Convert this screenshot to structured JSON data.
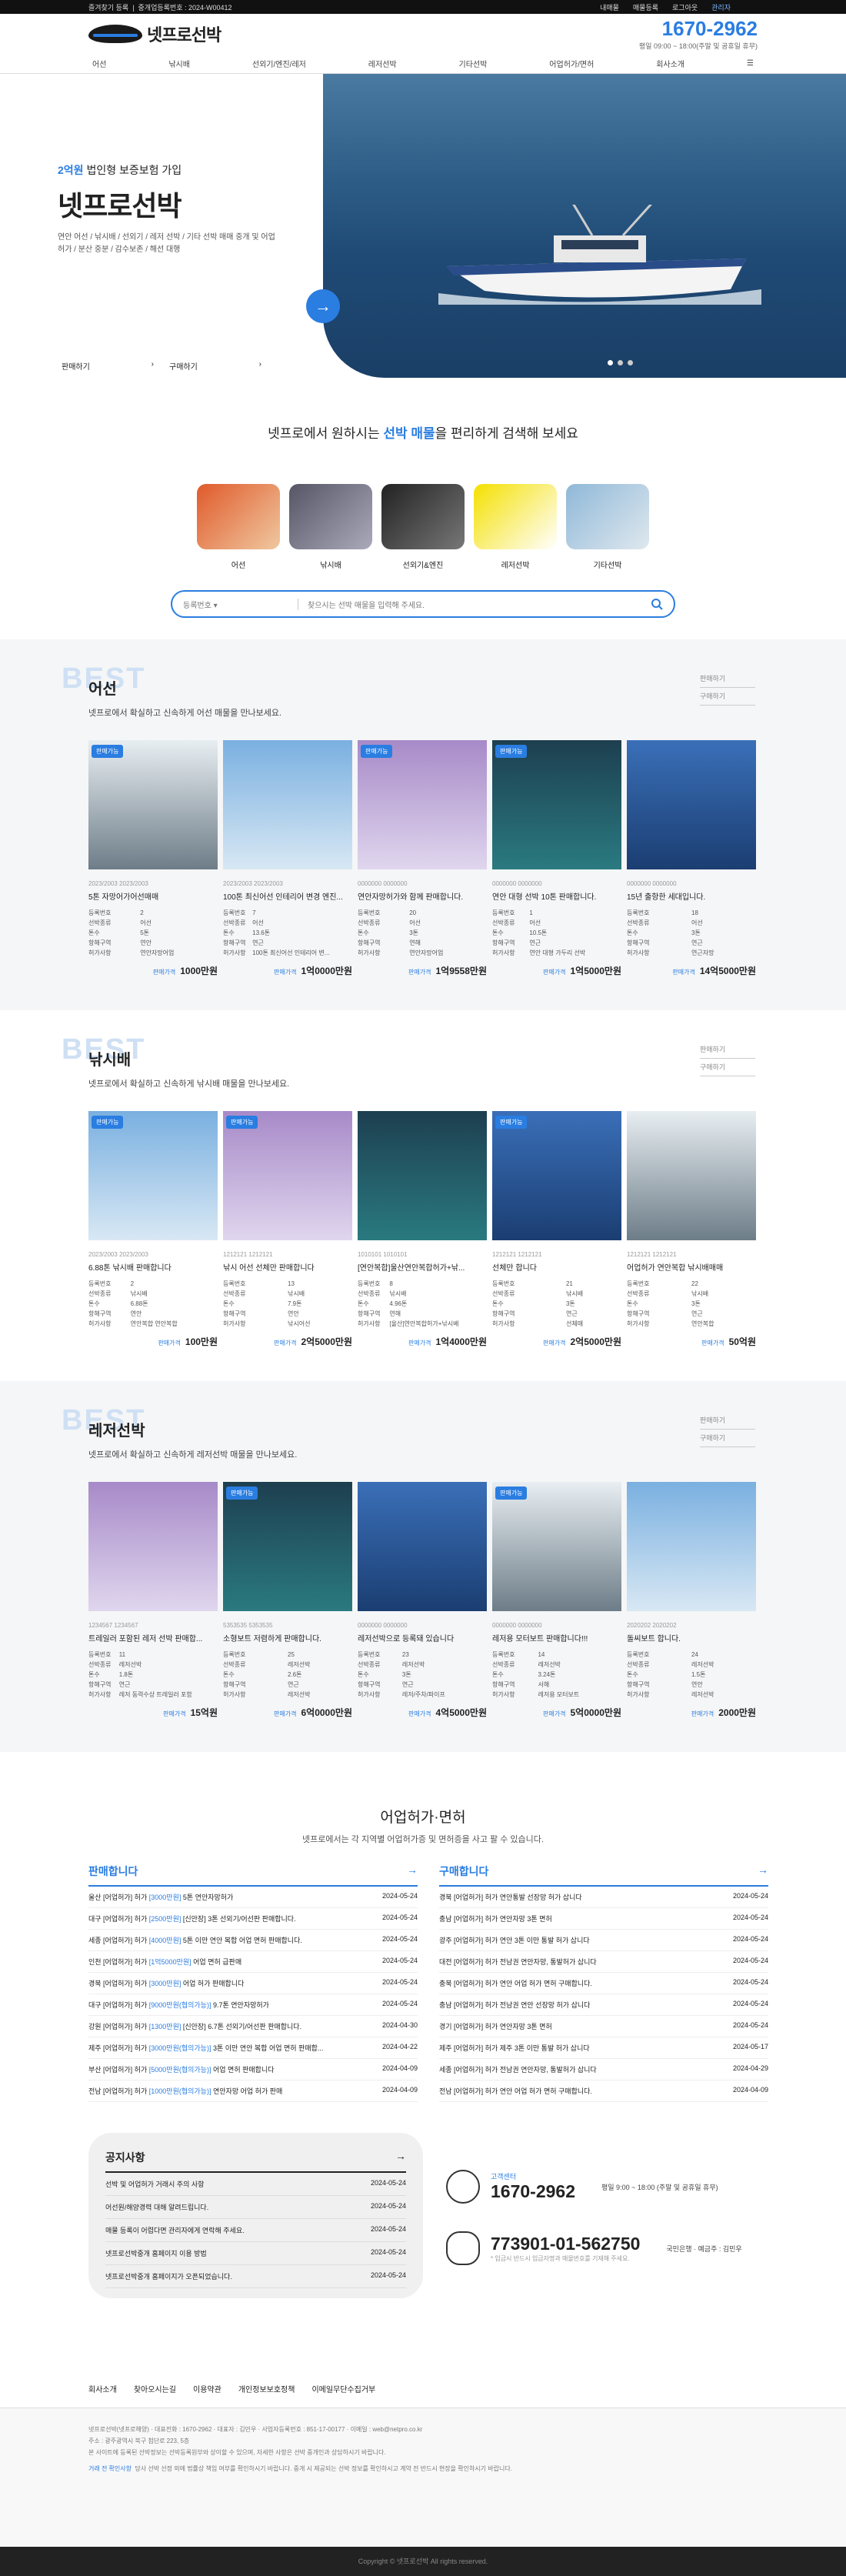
{
  "topbar": {
    "left1": "즐겨찾기 등록",
    "left2": "중개업등록번호 : 2024-W00412",
    "links": [
      "내매물",
      "매물등록",
      "로그아웃",
      "관리자"
    ]
  },
  "header": {
    "logo": "넷프로선박",
    "tel": "1670-2962",
    "hours": "평일 09:00 ~ 18:00(주말 및 공휴일 휴무)"
  },
  "nav": [
    "어선",
    "낚시배",
    "선외기/엔진/레저",
    "레저선박",
    "기타선박",
    "어업허가/면허",
    "회사소개",
    "☰"
  ],
  "hero": {
    "badge_pre": "2억원",
    "badge_post": "법인형 보증보험 가입",
    "title": "넷프로선박",
    "desc": "연안 어선 / 낚시배 / 선외기 / 레저 선박 / 기타 선박 매매 중개 및 어업허가 / 분산 중분 / 감수보존 / 해선 대행",
    "link1": "판매하기",
    "link2": "구매하기",
    "chev": "›",
    "arrow": "→"
  },
  "search": {
    "title_pre": "넷프로에서 원하시는",
    "title_hl": "선박 매물",
    "title_post": "을 편리하게 검색해 보세요",
    "cats": [
      "어선",
      "낚시배",
      "선외기&엔진",
      "레저선박",
      "기타선박"
    ],
    "select": "등록번호",
    "placeholder": "찾으시는 선박 매물을 입력해 주세요.",
    "icon": "search-icon"
  },
  "sections": [
    {
      "best": "BEST",
      "title": "어선",
      "desc": "넷프로에서 확실하고 신속하게 어선 매물을 만나보세요.",
      "mini": [
        "판매하기",
        "구매하기"
      ],
      "cards": [
        {
          "tag": "판매가능",
          "code": "2023/2003 2023/2003",
          "title": "5톤 자망어가어선매매",
          "rows": [
            [
              "등록번호",
              "2"
            ],
            [
              "선박종류",
              "어선"
            ],
            [
              "톤수",
              "5톤"
            ],
            [
              "항해구역",
              "연안"
            ],
            [
              "허가사항",
              "연안자망어업"
            ]
          ],
          "label": "판매가격",
          "price": "1000만원"
        },
        {
          "tag": "",
          "code": "2023/2003 2023/2003",
          "title": "100톤 최신어선 인테리어 변경 엔진...",
          "rows": [
            [
              "등록번호",
              "7"
            ],
            [
              "선박종류",
              "어선"
            ],
            [
              "톤수",
              "13.6톤"
            ],
            [
              "항해구역",
              "연근"
            ],
            [
              "허가사항",
              "100톤 최신어선 인테리어 변..."
            ]
          ],
          "label": "판매가격",
          "price": "1억0000만원"
        },
        {
          "tag": "판매가능",
          "code": "0000000 0000000",
          "title": "연안자망허가와 함께 판매합니다.",
          "rows": [
            [
              "등록번호",
              "20"
            ],
            [
              "선박종류",
              "어선"
            ],
            [
              "톤수",
              "3톤"
            ],
            [
              "항해구역",
              "연해"
            ],
            [
              "허가사항",
              "연안자망어업"
            ]
          ],
          "label": "판매가격",
          "price": "1억9558만원"
        },
        {
          "tag": "판매가능",
          "code": "0000000 0000000",
          "title": "연안 대형 선박 10톤 판매합니다.",
          "rows": [
            [
              "등록번호",
              "1"
            ],
            [
              "선박종류",
              "어선"
            ],
            [
              "톤수",
              "10.5톤"
            ],
            [
              "항해구역",
              "연근"
            ],
            [
              "허가사항",
              "연안 대형 가두리 선박"
            ]
          ],
          "label": "판매가격",
          "price": "1억5000만원"
        },
        {
          "tag": "",
          "code": "0000000 0000000",
          "title": "15년 출항한 세대입니다.",
          "rows": [
            [
              "등록번호",
              "18"
            ],
            [
              "선박종류",
              "어선"
            ],
            [
              "톤수",
              "3톤"
            ],
            [
              "항해구역",
              "연근"
            ],
            [
              "허가사항",
              "연근자망"
            ]
          ],
          "label": "판매가격",
          "price": "14억5000만원"
        }
      ]
    },
    {
      "best": "BEST",
      "title": "낚시배",
      "desc": "넷프로에서 확실하고 신속하게 낚시배 매물을 만나보세요.",
      "mini": [
        "판매하기",
        "구매하기"
      ],
      "cards": [
        {
          "tag": "판매가능",
          "code": "2023/2003 2023/2003",
          "title": "6.88톤 낚시배 판매합니다",
          "rows": [
            [
              "등록번호",
              "2"
            ],
            [
              "선박종류",
              "낚시배"
            ],
            [
              "톤수",
              "6.88톤"
            ],
            [
              "항해구역",
              "연안"
            ],
            [
              "허가사항",
              "연안복합 연안복합"
            ]
          ],
          "label": "판매가격",
          "price": "100만원"
        },
        {
          "tag": "판매가능",
          "code": "1212121 1212121",
          "title": "낚시 어선 선체만 판매합니다",
          "rows": [
            [
              "등록번호",
              "13"
            ],
            [
              "선박종류",
              "낚시배"
            ],
            [
              "톤수",
              "7.9톤"
            ],
            [
              "항해구역",
              "연안"
            ],
            [
              "허가사항",
              "낚시어선"
            ]
          ],
          "label": "판매가격",
          "price": "2억5000만원"
        },
        {
          "tag": "",
          "code": "1010101 1010101",
          "title": "[연안복합]울산연안복합허가+낚...",
          "rows": [
            [
              "등록번호",
              "8"
            ],
            [
              "선박종류",
              "낚시배"
            ],
            [
              "톤수",
              "4.96톤"
            ],
            [
              "항해구역",
              "연해"
            ],
            [
              "허가사항",
              "[울산]연안복합허가+낚시배"
            ]
          ],
          "label": "판매가격",
          "price": "1억4000만원"
        },
        {
          "tag": "판매가능",
          "code": "1212121 1212121",
          "title": "선체만 합니다",
          "rows": [
            [
              "등록번호",
              "21"
            ],
            [
              "선박종류",
              "낚시배"
            ],
            [
              "톤수",
              "3톤"
            ],
            [
              "항해구역",
              "연근"
            ],
            [
              "허가사항",
              "선체매"
            ]
          ],
          "label": "판매가격",
          "price": "2억5000만원"
        },
        {
          "tag": "",
          "code": "1212121 1212121",
          "title": "어업허가 연안복합 낚시배매매",
          "rows": [
            [
              "등록번호",
              "22"
            ],
            [
              "선박종류",
              "낚시배"
            ],
            [
              "톤수",
              "3톤"
            ],
            [
              "항해구역",
              "연근"
            ],
            [
              "허가사항",
              "연안복합"
            ]
          ],
          "label": "판매가격",
          "price": "50억원"
        }
      ]
    },
    {
      "best": "BEST",
      "title": "레저선박",
      "desc": "넷프로에서 확실하고 신속하게 레저선박 매물을 만나보세요.",
      "mini": [
        "판매하기",
        "구매하기"
      ],
      "cards": [
        {
          "tag": "",
          "code": "1234567 1234567",
          "title": "트레일러 포함된 레저 선박 판매합...",
          "rows": [
            [
              "등록번호",
              "11"
            ],
            [
              "선박종류",
              "레저선박"
            ],
            [
              "톤수",
              "1.8톤"
            ],
            [
              "항해구역",
              "연근"
            ],
            [
              "허가사항",
              "레저 동력수상 트레일러 포함"
            ]
          ],
          "label": "판매가격",
          "price": "15억원"
        },
        {
          "tag": "판매가능",
          "code": "5353535 5353535",
          "title": "소형보트 저렴하게 판매합니다.",
          "rows": [
            [
              "등록번호",
              "25"
            ],
            [
              "선박종류",
              "레저선박"
            ],
            [
              "톤수",
              "2.6톤"
            ],
            [
              "항해구역",
              "연근"
            ],
            [
              "허가사항",
              "레저선박"
            ]
          ],
          "label": "판매가격",
          "price": "6억0000만원"
        },
        {
          "tag": "",
          "code": "0000000 0000000",
          "title": "레저선박으로 등록돼 있습니다",
          "rows": [
            [
              "등록번호",
              "23"
            ],
            [
              "선박종류",
              "레저선박"
            ],
            [
              "톤수",
              "3톤"
            ],
            [
              "항해구역",
              "연근"
            ],
            [
              "허가사항",
              "레저/주차/파이프"
            ]
          ],
          "label": "판매가격",
          "price": "4억5000만원"
        },
        {
          "tag": "판매가능",
          "code": "0000000 0000000",
          "title": "레저용 모터보트 판매합니다!!!",
          "rows": [
            [
              "등록번호",
              "14"
            ],
            [
              "선박종류",
              "레저선박"
            ],
            [
              "톤수",
              "3.24톤"
            ],
            [
              "항해구역",
              "서해"
            ],
            [
              "허가사항",
              "레저용 모터보트"
            ]
          ],
          "label": "판매가격",
          "price": "5억0000만원"
        },
        {
          "tag": "",
          "code": "2020202 2020202",
          "title": "돌씨보트 합니다.",
          "rows": [
            [
              "등록번호",
              "24"
            ],
            [
              "선박종류",
              "레저선박"
            ],
            [
              "톤수",
              "1.5톤"
            ],
            [
              "항해구역",
              "연안"
            ],
            [
              "허가사항",
              "레저선박"
            ]
          ],
          "label": "판매가격",
          "price": "2000만원"
        }
      ]
    }
  ],
  "biz": {
    "title": "어업허가·면허",
    "sub": "넷프로에서는 각 지역별 어업허가증 및 면허증을 사고 팔 수 있습니다.",
    "sell": {
      "title": "판매합니다",
      "arrow": "→",
      "items": [
        {
          "a": "울산 [어업허가] 허가",
          "b": "[3000만원]",
          "c": "5톤 연안자망허가",
          "d": "2024-05-24"
        },
        {
          "a": "대구 [어업허가] 허가",
          "b": "[2500만원]",
          "c": "[신안장] 3톤 선외기/어선판 판매합니다.",
          "d": "2024-05-24"
        },
        {
          "a": "세종 [어업허가] 허가",
          "b": "[4000만원]",
          "c": "5톤 이만 연안 복합 어업 면허 판매합니다.",
          "d": "2024-05-24"
        },
        {
          "a": "인천 [어업허가] 허가",
          "b": "[1억5000만원]",
          "c": "어업 면허 급판매",
          "d": "2024-05-24"
        },
        {
          "a": "경북 [어업허가] 허가",
          "b": "[3000만원]",
          "c": "어업 허가 판매합니다",
          "d": "2024-05-24"
        },
        {
          "a": "대구 [어업허가] 허가",
          "b": "[9000만원(협의가능)]",
          "c": "9.7톤 연안자망허가",
          "d": "2024-05-24"
        },
        {
          "a": "강원 [어업허가] 허가",
          "b": "[1300만원]",
          "c": "[신안장] 6.7톤 선외기/어선판 판매합니다.",
          "d": "2024-04-30"
        },
        {
          "a": "제주 [어업허가] 허가",
          "b": "[3000만원(협의가능)]",
          "c": "3톤 이만 연안 복합 어업 면허 판매합...",
          "d": "2024-04-22"
        },
        {
          "a": "부산 [어업허가] 허가",
          "b": "[5000만원(협의가능)]",
          "c": "어업 면허 판매합니다",
          "d": "2024-04-09"
        },
        {
          "a": "전남 [어업허가] 허가",
          "b": "[1000만원(협의가능)]",
          "c": "연안자망 어업 허가 판매",
          "d": "2024-04-09"
        }
      ]
    },
    "buy": {
      "title": "구매합니다",
      "arrow": "→",
      "items": [
        {
          "a": "경북 [어업허가] 허가",
          "c": "연안통발 선장망 허가 삽니다",
          "d": "2024-05-24"
        },
        {
          "a": "충남 [어업허가] 허가",
          "c": "연안자망 3톤 면허",
          "d": "2024-05-24"
        },
        {
          "a": "광주 [어업허가] 허가",
          "c": "연안 3톤 이만 통발 허가 삽니다",
          "d": "2024-05-24"
        },
        {
          "a": "대전 [어업허가] 허가",
          "c": "전남권 연안자망, 통발허가 삽니다",
          "d": "2024-05-24"
        },
        {
          "a": "충북 [어업허가] 허가",
          "c": "연안 어업 허가 면허 구매합니다.",
          "d": "2024-05-24"
        },
        {
          "a": "충남 [어업허가] 허가",
          "c": "전남권 연안 선장망 허가 삽니다",
          "d": "2024-05-24"
        },
        {
          "a": "경기 [어업허가] 허가",
          "c": "연안자망 3톤 면허",
          "d": "2024-05-24"
        },
        {
          "a": "제주 [어업허가] 허가",
          "c": "제주 3톤 이만 통발 허가 삽니다",
          "d": "2024-05-17"
        },
        {
          "a": "세종 [어업허가] 허가",
          "c": "전남권 연안자망, 통발허가 삽니다",
          "d": "2024-04-29"
        },
        {
          "a": "전남 [어업허가] 허가",
          "c": "연안 어업 허가 면허 구매합니다.",
          "d": "2024-04-09"
        }
      ]
    }
  },
  "notice": {
    "title": "공지사항",
    "arrow": "→",
    "items": [
      {
        "t": "선박 및 어업허가 거래시 주의 사항",
        "d": "2024-05-24"
      },
      {
        "t": "어선원/해양경력 대해 알려드립니다.",
        "d": "2024-05-24"
      },
      {
        "t": "매물 등록이 어렵다면 관리자에게 연락해 주세요.",
        "d": "2024-05-24"
      },
      {
        "t": "넷프로선박중개 홈페이지 이용 방법",
        "d": "2024-05-24"
      },
      {
        "t": "넷프로선박중개 홈페이지가 오픈되었습니다.",
        "d": "2024-05-24"
      }
    ]
  },
  "contact": {
    "label": "고객센터",
    "tel": "1670-2962",
    "hours": "평일 9:00 ~ 18:00 (주말 및 공휴일 휴무)",
    "account": "773901-01-562750",
    "account_note": "* 입금시 반드시 입금자명과 매물번호를 기재해 주세요.",
    "bank": "국민은행 · 예금주 : 김민우"
  },
  "footer": {
    "links": [
      "회사소개",
      "찾아오시는길",
      "이용약관",
      "개인정보보호정책",
      "이메일무단수집거부"
    ],
    "info1": "넷프로선박(넷프로해양) · 대표전화 : 1670-2962 · 대표자 : 김민우 · 사업자등록번호 : 851-17-00177 · 이메일 : web@netpro.co.kr",
    "info2": "주소 : 광주광역시 북구 첨단로 223, 5층",
    "info3": "본 사이트에 등록된 선박정보는 선박등록원부와 상이할 수 있으며, 자세한 사항은 선박 중개인과 상담하시기 바랍니다.",
    "disclaimer_label": "거래 전 확인사항",
    "disclaimer": "당사 선박 선정 외에 법률상 책임 여부를 확인하시기 바랍니다. 중개 시 제공되는 선박 정보를 확인하시고 계약 전 반드시 현장을 확인하시기 바랍니다.",
    "copy": "Copyright © 넷프로선박 All rights reserved."
  }
}
